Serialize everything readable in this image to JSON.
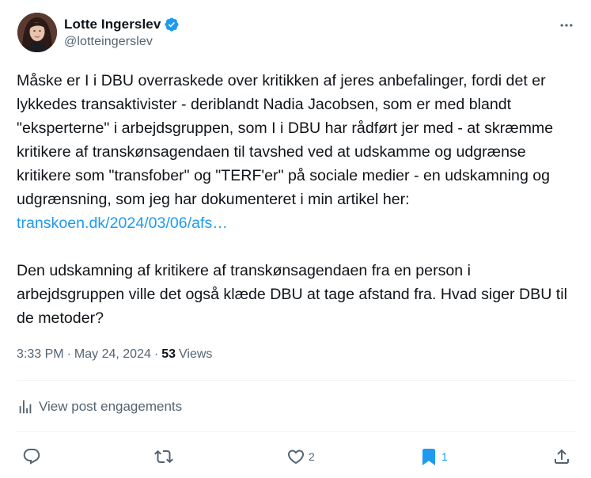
{
  "user": {
    "display_name": "Lotte Ingerslev",
    "handle": "@lotteingerslev",
    "verified": true,
    "avatar": "user-avatar"
  },
  "post": {
    "paragraph1_text": "Måske er I i DBU overraskede over kritikken af jeres anbefalinger, fordi det er lykkedes transaktivister - deriblandt Nadia Jacobsen, som er med blandt \"eksperterne\" i arbejdsgruppen, som I i DBU har rådført jer med - at skræmme kritikere af transkønsagendaen til tavshed ved at udskamme og udgrænse kritikere som \"transfober\" og \"TERF'er\" på sociale medier - en udskamning og udgrænsning, som jeg har dokumenteret i min artikel her: ",
    "link_text": "transkoen.dk/2024/03/06/afs…",
    "paragraph2_text": "Den udskamning af kritikere af transkønsagendaen fra en person i arbejdsgruppen ville det også klæde DBU at tage afstand fra. Hvad siger DBU til de metoder?"
  },
  "meta": {
    "time": "3:33 PM",
    "separator": "·",
    "date": "May 24, 2024",
    "views_count": "53",
    "views_label": "Views"
  },
  "engagements": {
    "label": "View post engagements",
    "icon": "analytics-icon"
  },
  "actions": {
    "reply": {
      "icon": "reply-icon",
      "count": ""
    },
    "repost": {
      "icon": "repost-icon",
      "count": ""
    },
    "like": {
      "icon": "heart-icon",
      "count": "2"
    },
    "bookmark": {
      "icon": "bookmark-icon",
      "count": "1",
      "active": true
    },
    "share": {
      "icon": "share-icon",
      "count": ""
    }
  },
  "colors": {
    "text_primary": "#0f1419",
    "text_secondary": "#536471",
    "link": "#1d9bf0",
    "verified_badge": "#1d9bf0",
    "divider": "#eff3f4"
  }
}
